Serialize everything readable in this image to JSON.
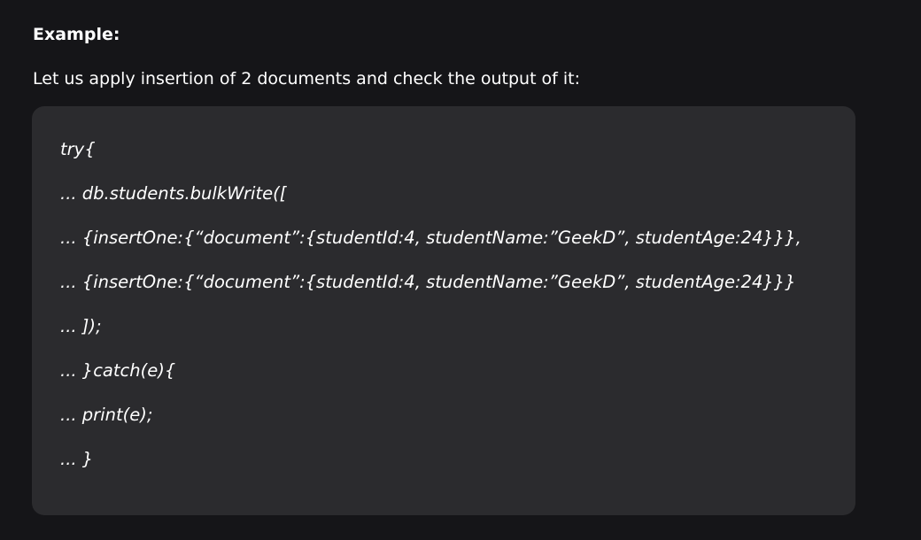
{
  "heading": "Example:",
  "intro": "Let us apply insertion of 2 documents and check the output of it:",
  "code_lines": [
    "try{",
    "... db.students.bulkWrite([",
    "... {insertOne:{“document”:{studentId:4, studentName:”GeekD”, studentAge:24}}},",
    "... {insertOne:{“document”:{studentId:4, studentName:”GeekD”, studentAge:24}}}",
    "... ]);",
    "... }catch(e){",
    "... print(e);",
    "... }"
  ]
}
